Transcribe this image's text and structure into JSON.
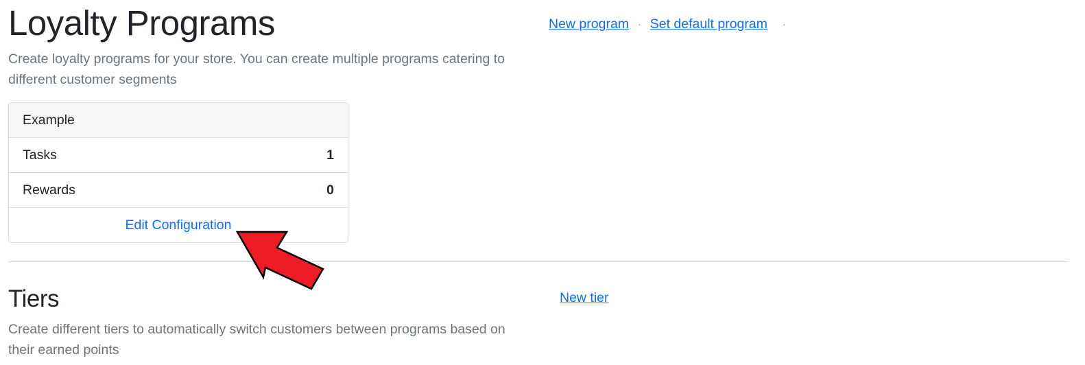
{
  "programs": {
    "title": "Loyalty Programs",
    "description": "Create loyalty programs for your store. You can create multiple programs catering to different customer segments",
    "actions": {
      "new_program": "New program",
      "separator": "·",
      "set_default": "Set default program"
    },
    "card": {
      "name": "Example",
      "rows": [
        {
          "label": "Tasks",
          "value": "1"
        },
        {
          "label": "Rewards",
          "value": "0"
        }
      ],
      "footer_link": "Edit Configuration"
    }
  },
  "tiers": {
    "title": "Tiers",
    "description": "Create different tiers to automatically switch customers between programs based on their earned points",
    "actions": {
      "new_tier": "New tier"
    }
  },
  "annotation": {
    "icon": "red-arrow-pointer",
    "color": "#ed1c24",
    "outline_color": "#000000"
  }
}
